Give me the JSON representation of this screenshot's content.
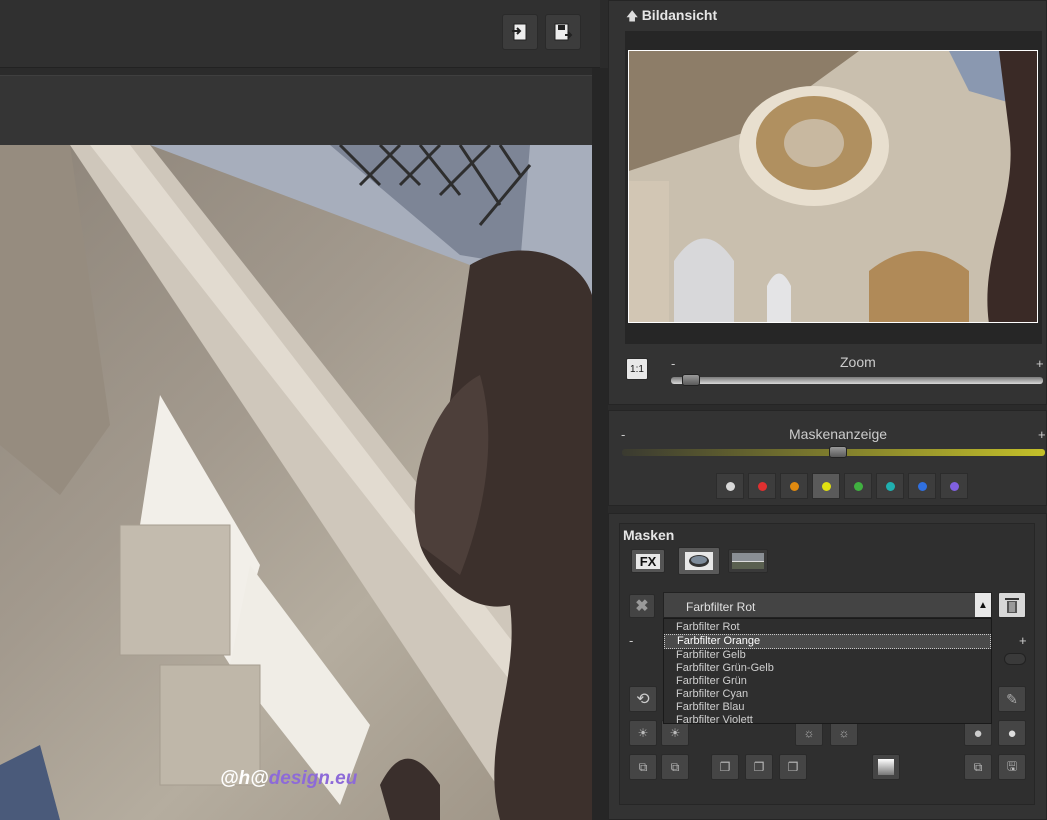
{
  "toolbar": {
    "import_icon": "import-icon",
    "save_icon": "save-icon"
  },
  "canvas": {
    "watermark_prefix": "@h@",
    "watermark_suffix": "design.eu"
  },
  "preview": {
    "title": "Bildansicht",
    "zoom_reset": "1:1",
    "zoom_label": "Zoom",
    "zoom_minus": "-",
    "zoom_plus": "+",
    "zoom_value": 0.03
  },
  "mask_display": {
    "label": "Maskenanzeige",
    "minus": "-",
    "plus": "+",
    "value": 0.51,
    "colors": [
      "#d8d8d8",
      "#e03030",
      "#e08a10",
      "#e0e010",
      "#40b040",
      "#20b0b0",
      "#3070e0",
      "#8060e0"
    ],
    "active_index": 3
  },
  "masks": {
    "title": "Masken",
    "tabs": [
      {
        "label": "FX"
      },
      {
        "label": "mask"
      },
      {
        "label": "landscape"
      }
    ],
    "selected": "Farbfilter Rot",
    "options": [
      "Farbfilter Rot",
      "Farbfilter Orange",
      "Farbfilter Gelb",
      "Farbfilter Grün-Gelb",
      "Farbfilter Grün",
      "Farbfilter Cyan",
      "Farbfilter Blau",
      "Farbfilter Violett"
    ],
    "highlighted_index": 1,
    "minus": "-",
    "plus": "+"
  }
}
